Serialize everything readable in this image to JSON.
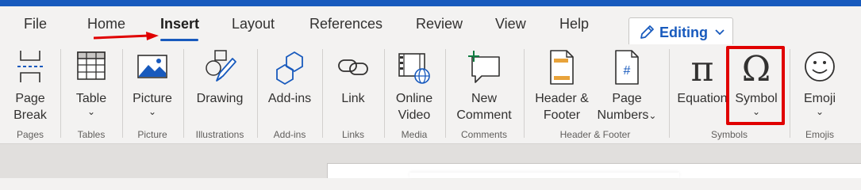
{
  "tabs": [
    {
      "label": "File"
    },
    {
      "label": "Home"
    },
    {
      "label": "Insert"
    },
    {
      "label": "Layout"
    },
    {
      "label": "References"
    },
    {
      "label": "Review"
    },
    {
      "label": "View"
    },
    {
      "label": "Help"
    }
  ],
  "active_tab": "Insert",
  "editing": {
    "label": "Editing",
    "icon": "pencil-icon"
  },
  "ribbon": {
    "page_break": {
      "line1": "Page",
      "line2": "Break"
    },
    "table": {
      "label": "Table"
    },
    "picture": {
      "label": "Picture"
    },
    "drawing": {
      "label": "Drawing"
    },
    "addins": {
      "label": "Add-ins"
    },
    "link": {
      "label": "Link"
    },
    "online_video": {
      "line1": "Online",
      "line2": "Video"
    },
    "new_comment": {
      "line1": "New",
      "line2": "Comment"
    },
    "header_footer": {
      "line1": "Header &",
      "line2": "Footer"
    },
    "page_numbers": {
      "line1": "Page",
      "line2": "Numbers"
    },
    "equation": {
      "label": "Equation"
    },
    "symbol": {
      "label": "Symbol"
    },
    "emoji": {
      "label": "Emoji"
    },
    "chevron": "⌄"
  },
  "groups": {
    "pages": "Pages",
    "tables": "Tables",
    "picture": "Picture",
    "illustrations": "Illustrations",
    "addins": "Add-ins",
    "links": "Links",
    "media": "Media",
    "comments": "Comments",
    "header_footer": "Header & Footer",
    "symbols": "Symbols",
    "emojis": "Emojis"
  },
  "colors": {
    "brand": "#185abd",
    "highlight": "#e00000",
    "annotation_arrow": "#e00000"
  }
}
